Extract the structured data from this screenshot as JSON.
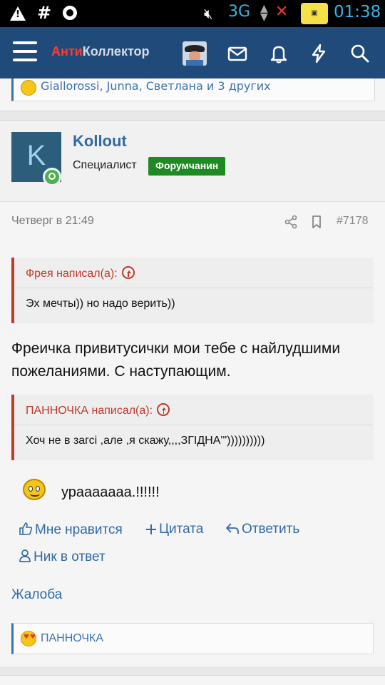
{
  "statusbar": {
    "network": "3G",
    "time": "01:38",
    "icons": [
      "warning-icon",
      "hash-icon",
      "key-icon",
      "mute-icon",
      "signal-arrows-icon",
      "no-signal-icon",
      "app-notification-icon"
    ]
  },
  "navbar": {
    "logo_part1": "Анти",
    "logo_part2": "Коллектор",
    "icons": [
      "menu-icon",
      "user-avatar",
      "mail-icon",
      "bell-icon",
      "bolt-icon",
      "search-icon"
    ],
    "background": "#1f4a7a"
  },
  "prev_post": {
    "reactions_text": "Giallorossi, Junna, Светлана и 3 других"
  },
  "post": {
    "avatar_letter": "K",
    "username": "Kollout",
    "user_title": "Специалист",
    "banner": "Форумчанин",
    "date": "Четверг в 21:49",
    "post_number": "#7178",
    "quote1": {
      "author": "Фрея написал(а):",
      "text": "Эх мечты)) но надо верить))"
    },
    "message": "Фреичка привитусички мои тебе с найлудшими пожеланиями. С наступающим.",
    "quote2": {
      "author": "ПАННОЧКА написал(а):",
      "text": "Хоч не в загсі ,але ,я скажу,,,,ЗГІДНА'\"))))))))))"
    },
    "smiley_text": "урааааааа.!!!!!!",
    "actions": {
      "like": "Мне нравится",
      "quote": "Цитата",
      "reply": "Ответить",
      "mention": "Ник в ответ",
      "report": "Жалоба"
    },
    "reactors": "ПАННОЧКА"
  },
  "colors": {
    "link": "#2f6aa6",
    "quote_accent": "#c0392b",
    "banner": "#1e8a24"
  }
}
